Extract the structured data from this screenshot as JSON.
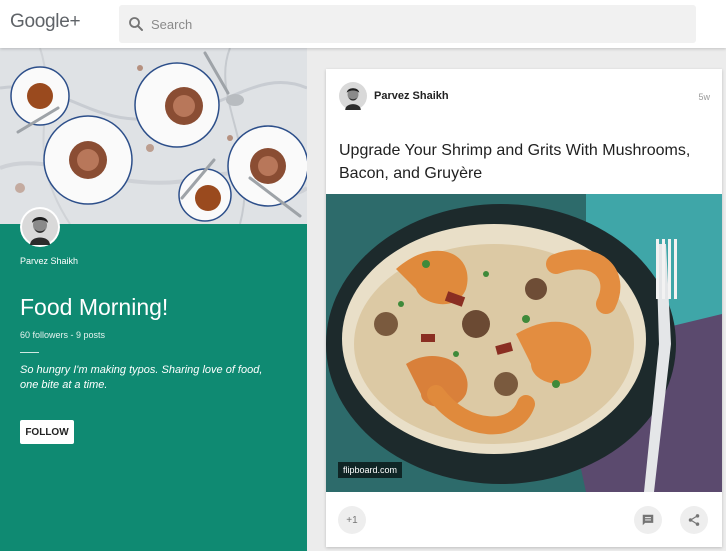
{
  "header": {
    "logo": "Google+",
    "search_placeholder": "Search"
  },
  "collection": {
    "owner_name": "Parvez Shaikh",
    "title": "Food Morning!",
    "stats": "60 followers - 9 posts",
    "description": "So hungry I'm making typos. Sharing love of food, one bite at a time.",
    "follow_label": "FOLLOW"
  },
  "post": {
    "author": "Parvez Shaikh",
    "time": "5w",
    "title": "Upgrade Your Shrimp and Grits With Mushrooms, Bacon, and Gruyère",
    "source": "flipboard.com",
    "plus_one_label": "+1"
  },
  "colors": {
    "accent": "#0f8a72",
    "card": "#ffffff",
    "background": "#ececec"
  },
  "icons": {
    "search": "search-icon",
    "comment": "comment-icon",
    "share": "share-icon"
  }
}
